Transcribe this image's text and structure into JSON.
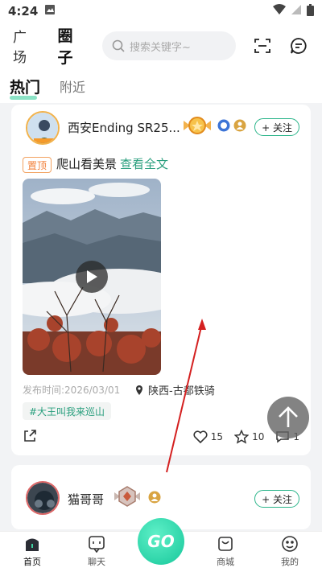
{
  "status_bar": {
    "time": "4:24"
  },
  "header": {
    "tab_plaza": "广场",
    "tab_circle": "圈子",
    "search_placeholder": "搜索关键字~"
  },
  "sub_tabs": {
    "hot": "热门",
    "nearby": "附近"
  },
  "posts": [
    {
      "username": "西安Ending SR25...",
      "follow_label": "+ 关注",
      "pin_label": "置顶",
      "title": "爬山看美景",
      "read_more": "查看全文",
      "publish_time": "发布时间:2026/03/01",
      "location": "陕西-古都铁骑",
      "topic": "#大王叫我来巡山",
      "likes": "15",
      "favorites": "10",
      "comments": "1"
    },
    {
      "username": "猫哥哥",
      "follow_label": "+ 关注"
    }
  ],
  "bottom_nav": {
    "home": "首页",
    "chat": "聊天",
    "center": "GO",
    "shop": "商城",
    "mine": "我的"
  },
  "colors": {
    "accent": "#16c79a",
    "pin": "#f2803a",
    "arrow": "#d42020"
  }
}
